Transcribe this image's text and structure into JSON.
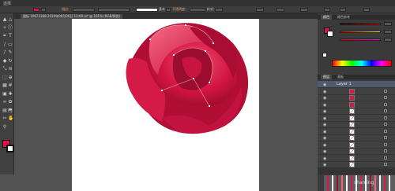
{
  "menubar": {
    "label": "选择"
  },
  "controlbar": {
    "stroke_label": "描边:",
    "opacity_label": "不透明度:",
    "style_label": "样式:",
    "stroke_weight": "基本"
  },
  "document_tab": {
    "label": "图标 10673188 2019年06月06日 12:00.ai* @ 161% (RGB/预览)"
  },
  "tools": [
    "selection-tool",
    "direct-selection-tool",
    "magic-wand-tool",
    "lasso-tool",
    "pen-tool",
    "type-tool",
    "line-tool",
    "rectangle-tool",
    "paintbrush-tool",
    "pencil-tool",
    "eraser-tool",
    "rotate-tool",
    "scale-tool",
    "width-tool",
    "free-transform-tool",
    "shape-builder-tool",
    "perspective-tool",
    "mesh-tool",
    "gradient-tool",
    "eyedropper-tool",
    "blend-tool",
    "symbol-sprayer-tool",
    "graph-tool",
    "artboard-tool",
    "slice-tool",
    "hand-tool",
    "zoom-tool"
  ],
  "colors": {
    "fill": "#e30f4b",
    "stroke": "#ffffff",
    "rose_dark": "#9b0d2f",
    "rose_mid": "#d51a47",
    "rose_light": "#f5627d"
  },
  "panels": {
    "color_tabs": [
      "颜色",
      "颜色参考"
    ],
    "layers_tabs": [
      "图层",
      "画板"
    ],
    "layer_name": "Layer 1"
  },
  "layer_rows": 13,
  "watermark": "shanjing"
}
